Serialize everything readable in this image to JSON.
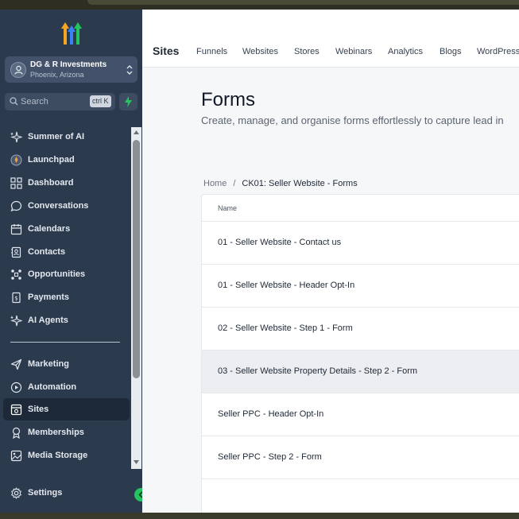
{
  "account": {
    "name": "DG & R Investments",
    "location": "Phoenix, Arizona"
  },
  "search": {
    "placeholder": "Search",
    "shortcut": "ctrl K"
  },
  "sidebar": {
    "items": [
      {
        "label": "Summer of AI",
        "icon": "sparkle-icon"
      },
      {
        "label": "Launchpad",
        "icon": "rocket-icon"
      },
      {
        "label": "Dashboard",
        "icon": "grid-icon"
      },
      {
        "label": "Conversations",
        "icon": "chat-icon"
      },
      {
        "label": "Calendars",
        "icon": "calendar-icon"
      },
      {
        "label": "Contacts",
        "icon": "contacts-icon"
      },
      {
        "label": "Opportunities",
        "icon": "opportunities-icon"
      },
      {
        "label": "Payments",
        "icon": "payments-icon"
      },
      {
        "label": "AI Agents",
        "icon": "sparkle-icon"
      },
      {
        "label": "Marketing",
        "icon": "send-icon"
      },
      {
        "label": "Automation",
        "icon": "automation-icon"
      },
      {
        "label": "Sites",
        "icon": "sites-icon"
      },
      {
        "label": "Memberships",
        "icon": "award-icon"
      },
      {
        "label": "Media Storage",
        "icon": "image-icon"
      },
      {
        "label": "Settings",
        "icon": "gear-icon"
      }
    ]
  },
  "header": {
    "section": "Sites",
    "tabs": [
      "Funnels",
      "Websites",
      "Stores",
      "Webinars",
      "Analytics",
      "Blogs",
      "WordPress"
    ]
  },
  "page": {
    "title": "Forms",
    "subtitle": "Create, manage, and organise forms effortlessly to capture lead in"
  },
  "breadcrumb": {
    "home": "Home",
    "separator": "/",
    "current": "CK01: Seller Website - Forms"
  },
  "table": {
    "header": "Name",
    "rows": [
      "01 - Seller Website - Contact us",
      "01 - Seller Website - Header Opt-In",
      "02 - Seller Website - Step 1 - Form",
      "03 - Seller Website Property Details - Step 2 - Form",
      "Seller PPC - Header Opt-In",
      "Seller PPC - Step 2 - Form"
    ]
  },
  "colors": {
    "sidebar_bg": "#2c3a4e",
    "accent_green": "#22c55e",
    "logo_orange": "#f5a623",
    "logo_blue": "#3b82f6",
    "logo_green": "#22c55e"
  }
}
